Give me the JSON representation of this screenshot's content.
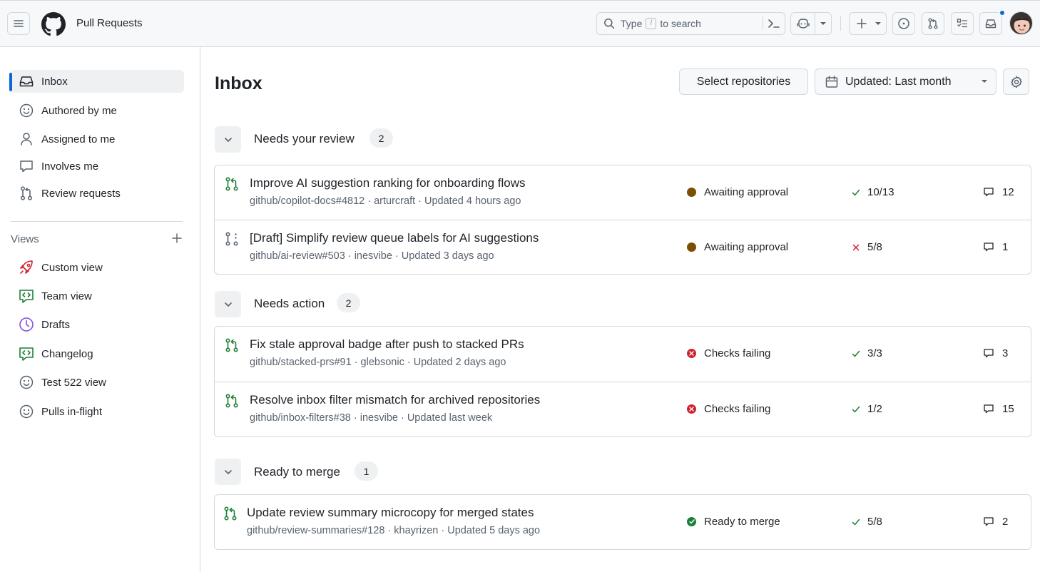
{
  "header": {
    "title": "Pull Requests",
    "search": {
      "prefix": "Type",
      "shortcut": "/",
      "suffix": "to search"
    }
  },
  "sidebar": {
    "items": [
      {
        "label": "Inbox",
        "icon": "inbox-icon",
        "active": true
      },
      {
        "label": "Authored by me",
        "icon": "smiley-icon"
      },
      {
        "label": "Assigned to me",
        "icon": "person-icon"
      },
      {
        "label": "Involves me",
        "icon": "comment-icon"
      },
      {
        "label": "Review requests",
        "icon": "git-pull-request-icon"
      }
    ],
    "views_label": "Views",
    "views": [
      {
        "label": "Custom view",
        "icon": "rocket-icon",
        "color": "#cf222e"
      },
      {
        "label": "Team view",
        "icon": "code-square-icon",
        "color": "#1a7f37"
      },
      {
        "label": "Drafts",
        "icon": "clock-icon",
        "color": "#8250df"
      },
      {
        "label": "Changelog",
        "icon": "code-square-icon",
        "color": "#1a7f37"
      },
      {
        "label": "Test 522 view",
        "icon": "smiley-icon",
        "color": "#59636e"
      },
      {
        "label": "Pulls in-flight",
        "icon": "smiley-icon",
        "color": "#59636e"
      }
    ]
  },
  "main": {
    "title": "Inbox",
    "select_repos_label": "Select repositories",
    "updated_filter_label": "Updated: Last month",
    "sections": [
      {
        "title": "Needs your review",
        "count": "2",
        "items": [
          {
            "title": "Improve AI suggestion ranking for onboarding flows",
            "meta": "github/copilot-docs#4812 · arturcraft · Updated 4 hours ago",
            "state": "open",
            "status": "Awaiting approval",
            "status_kind": "awaiting",
            "checks": "10/13",
            "checks_ok": true,
            "comments": "12"
          },
          {
            "title": "[Draft] Simplify review queue labels for AI suggestions",
            "meta": "github/ai-review#503 · inesvibe · Updated 3 days ago",
            "state": "draft",
            "status": "Awaiting approval",
            "status_kind": "awaiting",
            "checks": "5/8",
            "checks_ok": false,
            "comments": "1"
          }
        ]
      },
      {
        "title": "Needs action",
        "count": "2",
        "items": [
          {
            "title": "Fix stale approval badge after push to stacked PRs",
            "meta": "github/stacked-prs#91 · glebsonic · Updated 2 days ago",
            "state": "open",
            "status": "Checks failing",
            "status_kind": "failing",
            "checks": "3/3",
            "checks_ok": true,
            "comments": "3"
          },
          {
            "title": "Resolve inbox filter mismatch for archived repositories",
            "meta": "github/inbox-filters#38 · inesvibe · Updated last week",
            "state": "open",
            "status": "Checks failing",
            "status_kind": "failing",
            "checks": "1/2",
            "checks_ok": true,
            "comments": "15"
          }
        ]
      },
      {
        "title": "Ready to merge",
        "count": "1",
        "items": [
          {
            "title": "Update review summary microcopy for merged states",
            "meta": "github/review-summaries#128 · khayrizen · Updated 5 days ago",
            "state": "open",
            "status": "Ready to merge",
            "status_kind": "ready",
            "checks": "5/8",
            "checks_ok": true,
            "comments": "2"
          }
        ]
      }
    ]
  },
  "colors": {
    "accent": "#0969da",
    "open_green": "#1a7f37",
    "awaiting": "#7d4e00",
    "failing": "#cf222e",
    "ready": "#1a7f37",
    "check_ok": "#1a7f37",
    "check_fail": "#cf222e"
  }
}
